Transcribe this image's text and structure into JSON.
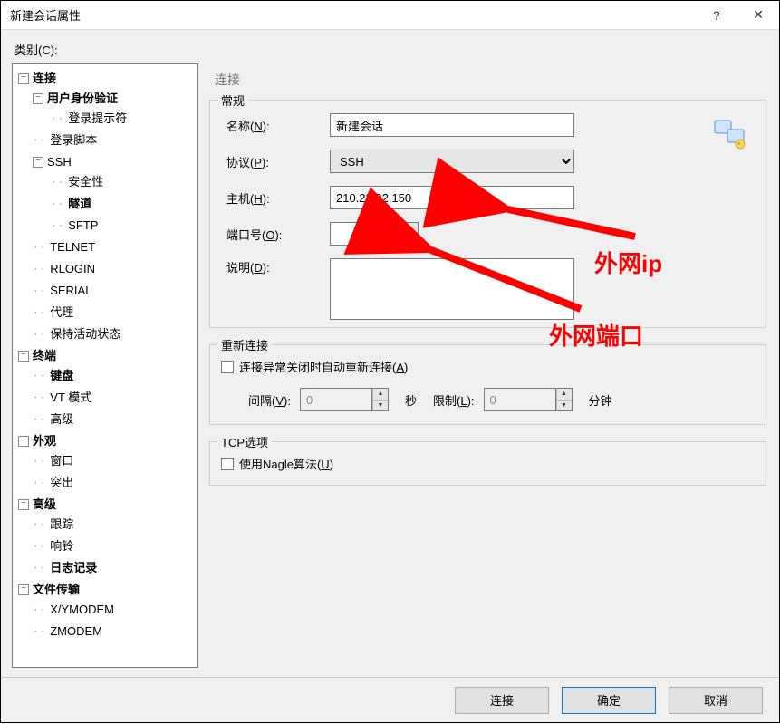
{
  "titlebar": {
    "title": "新建会话属性"
  },
  "category_label": "类别(C):",
  "tree": {
    "connection": {
      "label": "连接",
      "bold": true,
      "user_auth": {
        "label": "用户身份验证",
        "bold": true,
        "login_prompt": {
          "label": "登录提示符"
        }
      },
      "login_script": {
        "label": "登录脚本"
      },
      "ssh": {
        "label": "SSH",
        "security": {
          "label": "安全性"
        },
        "tunnel": {
          "label": "隧道",
          "bold": true
        },
        "sftp": {
          "label": "SFTP"
        }
      },
      "telnet": {
        "label": "TELNET"
      },
      "rlogin": {
        "label": "RLOGIN"
      },
      "serial": {
        "label": "SERIAL"
      },
      "proxy": {
        "label": "代理"
      },
      "keepalive": {
        "label": "保持活动状态"
      }
    },
    "terminal": {
      "label": "终端",
      "bold": true,
      "keyboard": {
        "label": "键盘",
        "bold": true
      },
      "vt_mode": {
        "label": "VT 模式"
      },
      "advanced": {
        "label": "高级"
      }
    },
    "appearance": {
      "label": "外观",
      "bold": true,
      "window": {
        "label": "窗口"
      },
      "highlight": {
        "label": "突出"
      }
    },
    "advanced": {
      "label": "高级",
      "bold": true,
      "trace": {
        "label": "跟踪"
      },
      "bell": {
        "label": "响铃"
      },
      "logging": {
        "label": "日志记录",
        "bold": true
      }
    },
    "filetransfer": {
      "label": "文件传输",
      "bold": true,
      "xymodem": {
        "label": "X/YMODEM"
      },
      "zmodem": {
        "label": "ZMODEM"
      }
    }
  },
  "section_header": "连接",
  "general_group": {
    "legend": "常规",
    "name_label": "名称(N):",
    "name_value": "新建会话",
    "protocol_label": "协议(P):",
    "protocol_value": "SSH",
    "host_label": "主机(H):",
    "host_value": "210.22.22.150",
    "port_label": "端口号(O):",
    "port_value": "",
    "desc_label": "说明(D):",
    "desc_value": ""
  },
  "reconnect_group": {
    "legend": "重新连接",
    "checkbox_label": "连接异常关闭时自动重新连接(A)",
    "interval_label": "间隔(V):",
    "interval_value": "0",
    "interval_unit": "秒",
    "limit_label": "限制(L):",
    "limit_value": "0",
    "limit_unit": "分钟"
  },
  "tcp_group": {
    "legend": "TCP选项",
    "nagle_label": "使用Nagle算法(U)"
  },
  "footer": {
    "connect": "连接",
    "ok": "确定",
    "cancel": "取消"
  },
  "annotations": {
    "ip_label": "外网ip",
    "port_label": "外网端口"
  }
}
